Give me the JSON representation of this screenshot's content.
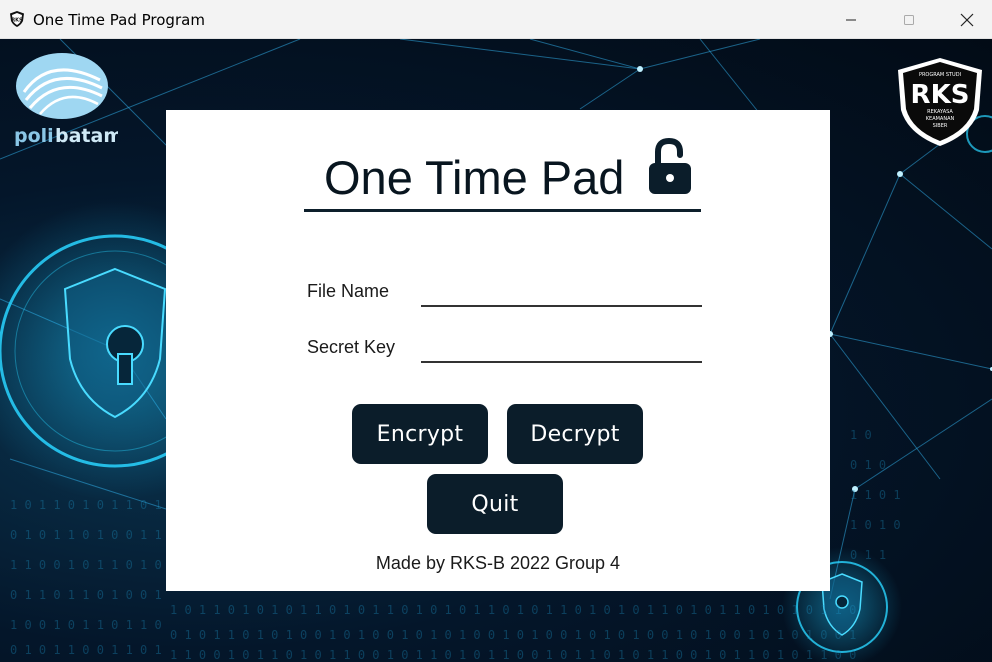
{
  "window": {
    "title": "One Time Pad Program",
    "icon": "rks-shield-icon",
    "controls": [
      "minimize-icon",
      "maximize-icon",
      "close-icon"
    ]
  },
  "logos": {
    "left": "polibatam",
    "right": {
      "top_text": "PROGRAM STUDI",
      "main": "RKS",
      "line1": "REKAYASA",
      "line2": "KEAMANAN",
      "line3": "SIBER"
    }
  },
  "card": {
    "heading": "One Time Pad",
    "heading_icon": "lock-open-icon",
    "fields": {
      "file_name_label": "File Name",
      "file_name_value": "",
      "secret_key_label": "Secret Key",
      "secret_key_value": ""
    },
    "buttons": {
      "encrypt": "Encrypt",
      "decrypt": "Decrypt",
      "quit": "Quit"
    },
    "footer": "Made by RKS-B 2022 Group 4"
  },
  "colors": {
    "button_bg": "#0b1d2a",
    "heading": "#08151f",
    "background_glow": "#1ec8ff"
  }
}
